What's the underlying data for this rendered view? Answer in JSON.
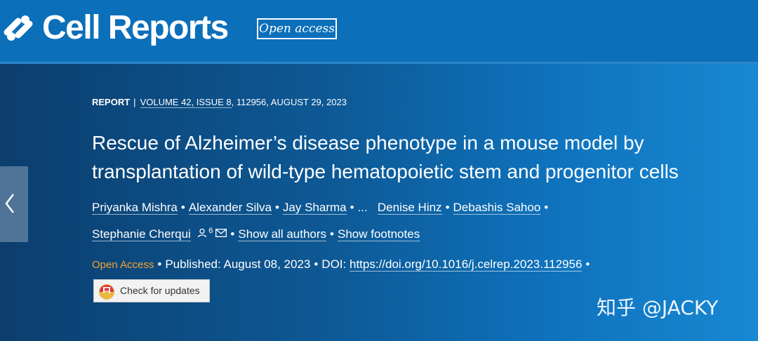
{
  "header": {
    "logo_icon": "cell-press-logo-icon",
    "logo_text": "Cell Reports",
    "badge": "Open access"
  },
  "article": {
    "type": "REPORT",
    "separator": "|",
    "volume_issue": "VOLUME 42, ISSUE 8",
    "meta_rest": ", 112956, AUGUST 29, 2023",
    "title": "Rescue of Alzheimer’s disease phenotype in a mouse model by transplantation of wild-type hematopoietic stem and progenitor cells",
    "authors": [
      "Priyanka Mishra",
      "Alexander Silva",
      "Jay Sharma",
      "Denise Hinz",
      "Debashis Sahoo",
      "Stephanie Cherqui"
    ],
    "ellipsis": "...",
    "bullet": "•",
    "person_icon": "person-icon",
    "footnote_count": "6",
    "mail_icon": "mail-icon",
    "show_all_authors": "Show all authors",
    "show_footnotes": "Show footnotes",
    "open_access_label": "Open Access",
    "published": "Published: August 08, 2023",
    "doi_label": "DOI:",
    "doi_link": "https://doi.org/10.1016/j.celrep.2023.112956",
    "check_updates": "Check for updates",
    "check_updates_icon": "crossmark-icon"
  },
  "carousel": {
    "prev_icon": "chevron-left-icon"
  },
  "watermark": "知乎 @JACKY",
  "colors": {
    "header_bg": "#0b6fba",
    "hero_dark": "#0c3e6e",
    "hero_light": "#1888d2",
    "open_access_orange": "#f7a233"
  }
}
